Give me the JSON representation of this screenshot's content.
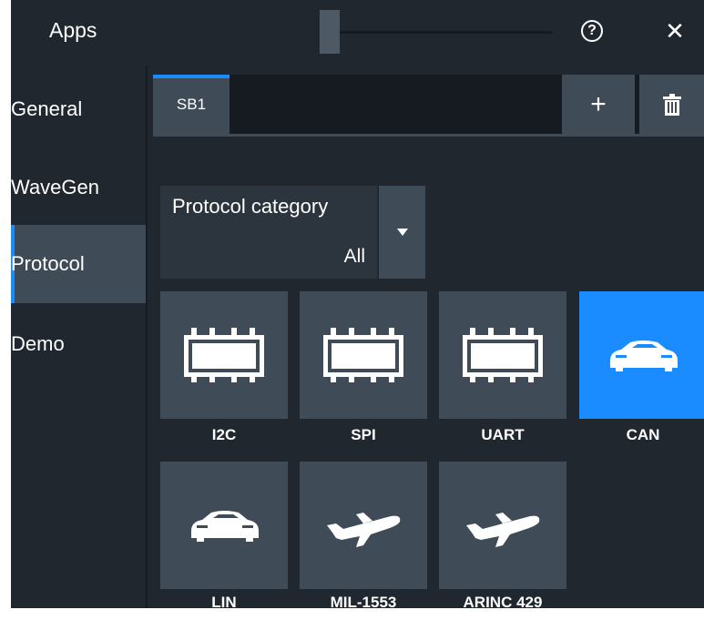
{
  "header": {
    "title": "Apps"
  },
  "sidebar": {
    "items": [
      {
        "label": "General"
      },
      {
        "label": "WaveGen"
      },
      {
        "label": "Protocol",
        "active": true
      },
      {
        "label": "Demo"
      }
    ]
  },
  "tabs": [
    {
      "label": "SB1",
      "active": true
    }
  ],
  "toolbar": {
    "add_label": "+"
  },
  "protocol_category": {
    "label": "Protocol category",
    "value": "All"
  },
  "protocols": [
    {
      "label": "I2C",
      "icon": "chip-icon"
    },
    {
      "label": "SPI",
      "icon": "chip-icon"
    },
    {
      "label": "UART",
      "icon": "chip-icon"
    },
    {
      "label": "CAN",
      "icon": "car-icon",
      "selected": true
    },
    {
      "label": "LIN",
      "icon": "car-icon"
    },
    {
      "label": "MIL-1553",
      "icon": "airplane-icon"
    },
    {
      "label": "ARINC 429",
      "icon": "airplane-icon"
    }
  ],
  "colors": {
    "accent": "#1a8cff",
    "panel": "#3f4b56",
    "background": "#20272e"
  }
}
